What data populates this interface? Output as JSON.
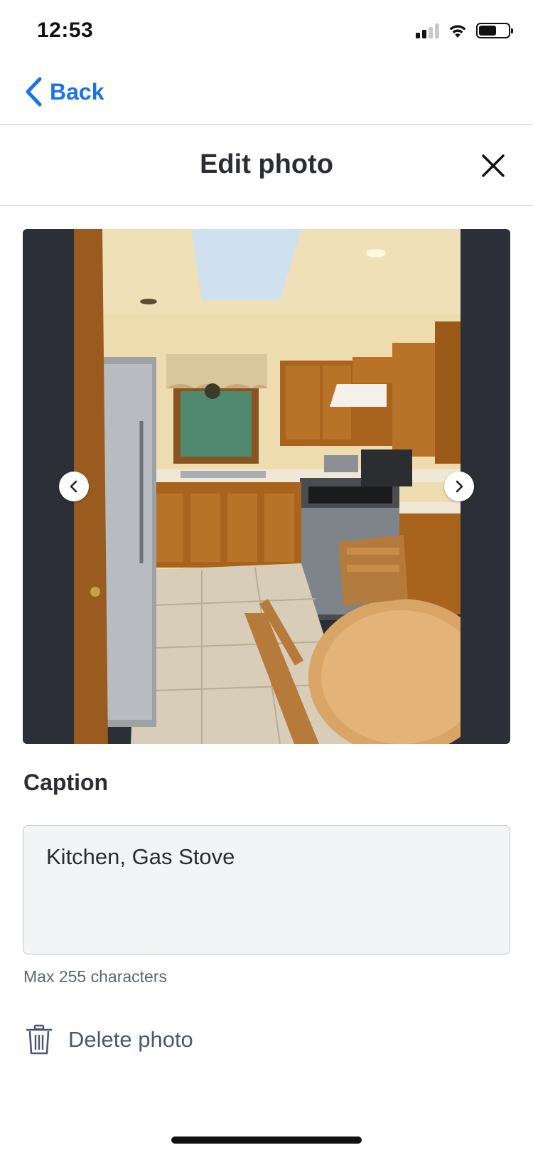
{
  "status_bar": {
    "time": "12:53",
    "signal_bars_active": 2,
    "signal_bars_total": 4,
    "battery_level": 0.6
  },
  "nav": {
    "back_label": "Back",
    "back_icon": "chevron-left-icon"
  },
  "header": {
    "title": "Edit photo",
    "close_icon": "close-icon"
  },
  "photo_viewer": {
    "prev_icon": "chevron-left-icon",
    "next_icon": "chevron-right-icon",
    "photo_subject": "kitchen with gas stove, wood cabinets, refrigerator and table"
  },
  "caption": {
    "label": "Caption",
    "value": "Kitchen, Gas Stove",
    "hint": "Max 255 characters"
  },
  "actions": {
    "delete_label": "Delete photo",
    "delete_icon": "trash-icon"
  },
  "colors": {
    "accent": "#1a73e8",
    "frame_bg": "#2c2f37",
    "delete_text": "#4a5673",
    "input_bg": "#f3f4f6"
  }
}
